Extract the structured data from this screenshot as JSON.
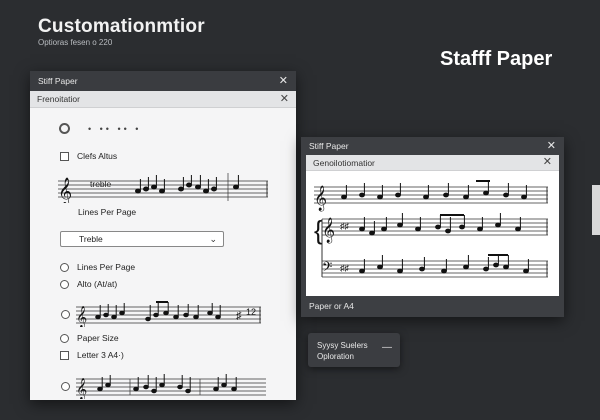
{
  "background": {
    "title": "Customationmtior",
    "subtitle": "Optioras fesen o 220",
    "brand": "Stafff Paper"
  },
  "left_window": {
    "title": "Stiff Paper",
    "subbar": "Frenoitatior",
    "items": {
      "clefs": "Clefs  Altus",
      "staff1_label": "treble",
      "lines_per_page_1": "Lines Per Page",
      "select_value": "Treble",
      "lines_per_page_2": "Lines Per Page",
      "alto": "Alto (At/at)",
      "staff2_number": "12",
      "paper_size": "Paper Size",
      "letter": "Letter 3 A4·)"
    }
  },
  "right_window": {
    "title": "Stiff Paper",
    "subbar": "Genoilotiomatior",
    "footer": "Paper or A4"
  },
  "toast": {
    "line1": "Syysy Suelers",
    "line2": "Oploration",
    "dismiss": "—"
  },
  "icons": {
    "close": "close-icon",
    "chevron": "chevron-down-icon",
    "clef": "treble-clef-icon"
  }
}
